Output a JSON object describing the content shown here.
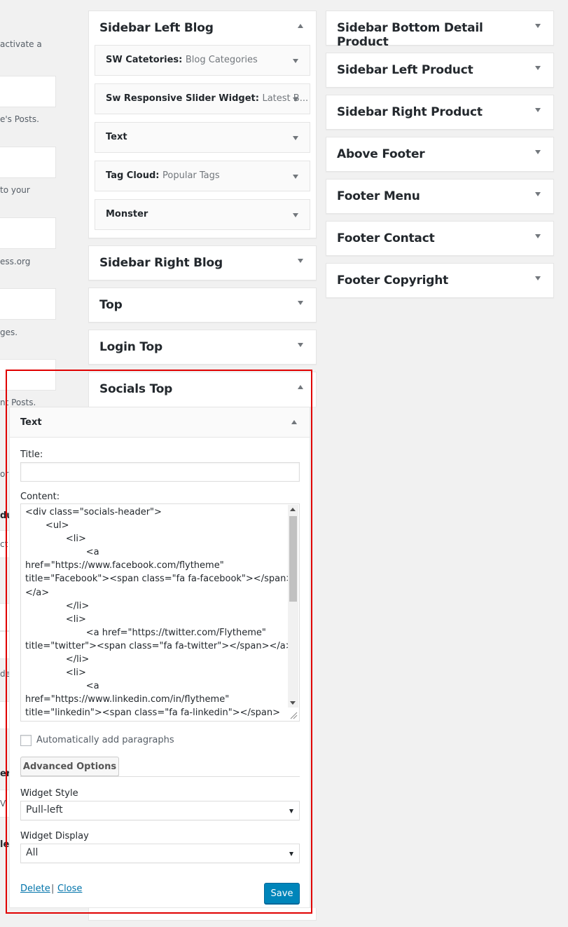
{
  "left_fragments": {
    "f1": "activate a",
    "f2": "e's Posts.",
    "f3": "to your",
    "f4": "ess.org",
    "f5": "ges.",
    "f6": "nt Posts.",
    "f7": "or",
    "f8": "du",
    "f9": "ct",
    "f10": "de",
    "f11": "er",
    "f12": "V",
    "f13": "le"
  },
  "sidebars_left": [
    {
      "title": "Sidebar Left Blog",
      "widgets": [
        {
          "name": "SW Catetories:",
          "sub": "Blog Categories"
        },
        {
          "name": "Sw Responsive Slider Widget:",
          "sub": "Latest B..."
        },
        {
          "name": "Text",
          "sub": ""
        },
        {
          "name": "Tag Cloud:",
          "sub": "Popular Tags"
        },
        {
          "name": "Monster",
          "sub": ""
        }
      ]
    },
    {
      "title": "Sidebar Right Blog"
    },
    {
      "title": "Top"
    },
    {
      "title": "Login Top"
    },
    {
      "title": "Socials Top"
    }
  ],
  "sidebars_right": [
    {
      "title": "Sidebar Bottom Detail Product"
    },
    {
      "title": "Sidebar Left Product"
    },
    {
      "title": "Sidebar Right Product"
    },
    {
      "title": "Above Footer"
    },
    {
      "title": "Footer Menu"
    },
    {
      "title": "Footer Contact"
    },
    {
      "title": "Footer Copyright"
    }
  ],
  "open_widget": {
    "title": "Text",
    "title_label": "Title:",
    "title_value": "",
    "content_label": "Content:",
    "content_text": "<div class=\"socials-header\">\n       <ul>\n              <li>\n                     <a\nhref=\"https://www.facebook.com/flytheme\"\ntitle=\"Facebook\"><span class=\"fa fa-facebook\"></span>\n</a>\n              </li>\n              <li>\n                     <a href=\"https://twitter.com/Flytheme\"\ntitle=\"twitter\"><span class=\"fa fa-twitter\"></span></a>\n              </li>\n              <li>\n                     <a\nhref=\"https://www.linkedin.com/in/flytheme\"\ntitle=\"linkedin\"><span class=\"fa fa-linkedin\"></span>",
    "auto_paragraphs_label": "Automatically add paragraphs",
    "auto_paragraphs_checked": false,
    "advanced_label": "Advanced Options",
    "style_label": "Widget Style",
    "style_value": "Pull-left",
    "display_label": "Widget Display",
    "display_value": "All",
    "delete_label": "Delete",
    "separator": "|",
    "close_label": "Close",
    "save_label": "Save"
  },
  "colors": {
    "highlight": "#e00000",
    "primary_button": "#0085ba",
    "link": "#0073aa"
  }
}
